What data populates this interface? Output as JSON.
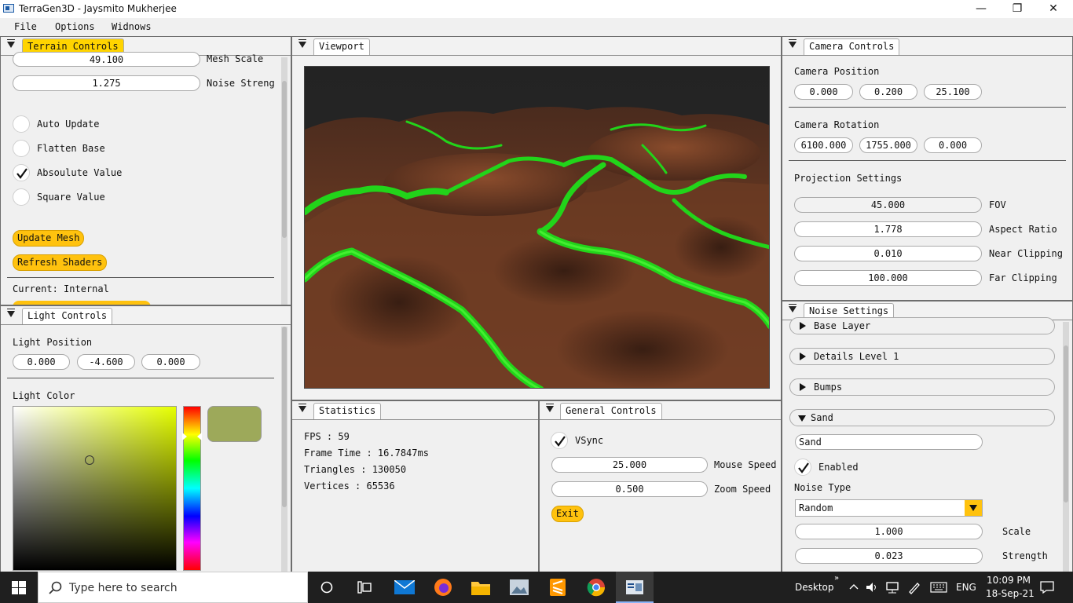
{
  "window": {
    "title": "TerraGen3D - Jaysmito Mukherjee",
    "minimize": "—",
    "maximize": "❐",
    "close": "✕"
  },
  "menu": [
    "File",
    "Options",
    "Widnows"
  ],
  "terrain": {
    "tab": "Terrain Controls",
    "mesh_scale_value": "49.100",
    "mesh_scale_label": "Mesh Scale",
    "noise_strength_value": "1.275",
    "noise_strength_label": "Noise Streng",
    "options": [
      {
        "label": "Auto Update",
        "checked": false
      },
      {
        "label": "Flatten Base",
        "checked": false
      },
      {
        "label": "Absoulute Value",
        "checked": true
      },
      {
        "label": "Square Value",
        "checked": false
      }
    ],
    "update_mesh": "Update Mesh",
    "refresh_shaders": "Refresh Shaders",
    "current": "Current: Internal"
  },
  "light": {
    "tab": "Light Controls",
    "position_label": "Light Position",
    "position": [
      "0.000",
      "-4.600",
      "0.000"
    ],
    "color_label": "Light Color",
    "swatch": "#9da95a",
    "hue": "#e6ff00"
  },
  "viewport": {
    "tab": "Viewport"
  },
  "statistics": {
    "tab": "Statistics",
    "lines": [
      "FPS         : 59",
      "Frame Time  : 16.7847ms",
      "Triangles   : 130050",
      "Vertices  : 65536"
    ]
  },
  "general": {
    "tab": "General Controls",
    "vsync": "VSync",
    "mouse_speed_value": "25.000",
    "mouse_speed_label": "Mouse Speed",
    "zoom_speed_value": "0.500",
    "zoom_speed_label": "Zoom Speed",
    "exit": "Exit"
  },
  "camera": {
    "tab": "Camera Controls",
    "position_label": "Camera Position",
    "position": [
      "0.000",
      "0.200",
      "25.100"
    ],
    "rotation_label": "Camera Rotation",
    "rotation": [
      "6100.000",
      "1755.000",
      "0.000"
    ],
    "projection_label": "Projection Settings",
    "projection": [
      {
        "value": "45.000",
        "label": "FOV"
      },
      {
        "value": "1.778",
        "label": "Aspect Ratio"
      },
      {
        "value": "0.010",
        "label": "Near Clipping"
      },
      {
        "value": "100.000",
        "label": "Far Clipping"
      }
    ]
  },
  "noise": {
    "tab": "Noise Settings",
    "layers": [
      "Base Layer",
      "Details Level 1",
      "Bumps",
      "Sand"
    ],
    "sand_name": "Sand",
    "enabled": "Enabled",
    "noise_type_label": "Noise Type",
    "noise_type_value": "Random",
    "scale_value": "1.000",
    "scale_label": "Scale",
    "strength_value": "0.023",
    "strength_label": "Strength"
  },
  "taskbar": {
    "search_placeholder": "Type here to search",
    "desktop": "Desktop",
    "lang": "ENG",
    "time": "10:09 PM",
    "date": "18-Sep-21"
  }
}
